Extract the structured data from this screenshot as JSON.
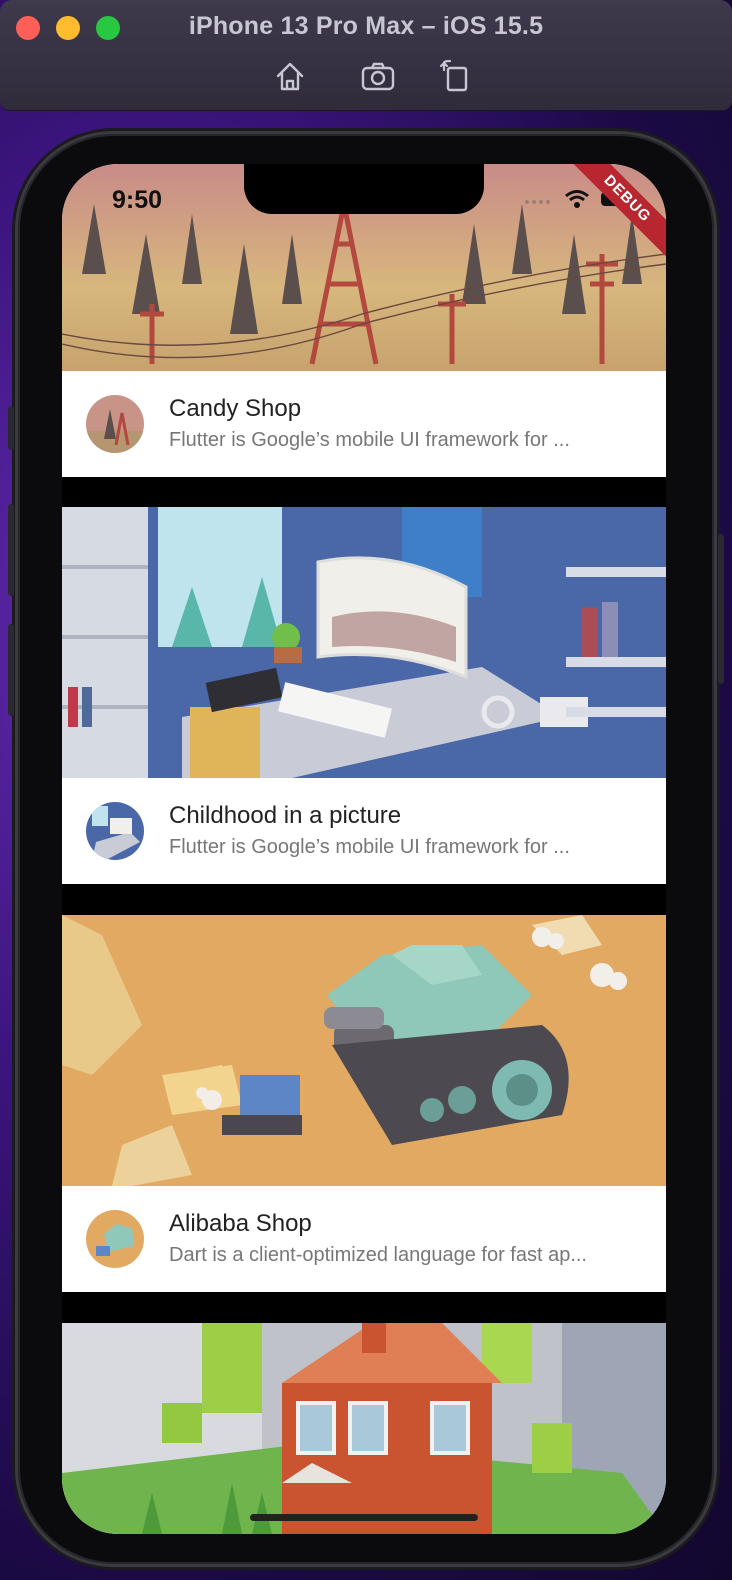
{
  "window": {
    "title": "iPhone 13 Pro Max – iOS 15.5",
    "toolbar": [
      "home-icon",
      "screenshot-icon",
      "rotate-icon"
    ]
  },
  "status_bar": {
    "time": "9:50",
    "debug_label": "DEBUG"
  },
  "cards": [
    {
      "title": "Candy Shop",
      "subtitle": "Flutter is Google’s mobile UI framework for ...",
      "image": "low-poly forest with red power line towers"
    },
    {
      "title": "Childhood in a picture",
      "subtitle": "Flutter is Google’s mobile UI framework for ...",
      "image": "low-poly room with desk and curved monitor"
    },
    {
      "title": "Alibaba Shop",
      "subtitle": "Dart is a client-optimized language for fast ap...",
      "image": "low-poly desert with green tank robot"
    },
    {
      "title": "",
      "subtitle": "",
      "image": "low-poly red house in green neighborhood"
    }
  ],
  "colors": {
    "debug_ribbon": "#b8262f",
    "background": "#3d1580"
  }
}
